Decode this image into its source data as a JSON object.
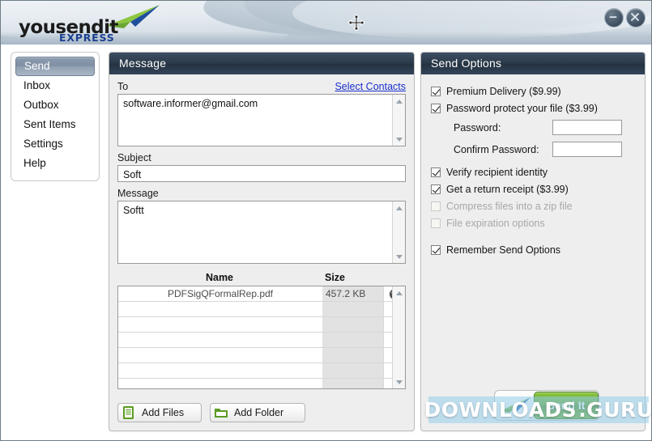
{
  "window": {
    "logo_word": "yousendit",
    "logo_sub": "EXPRESS",
    "minimize_label": "–",
    "close_label": "×",
    "cursor": "move-cursor"
  },
  "sidebar": {
    "items": [
      {
        "label": "Send",
        "selected": true
      },
      {
        "label": "Inbox",
        "selected": false
      },
      {
        "label": "Outbox",
        "selected": false
      },
      {
        "label": "Sent Items",
        "selected": false
      },
      {
        "label": "Settings",
        "selected": false
      },
      {
        "label": "Help",
        "selected": false
      }
    ]
  },
  "message_panel": {
    "title": "Message",
    "to_label": "To",
    "select_contacts_label": "Select Contacts",
    "to_value": "software.informer@gmail.com",
    "subject_label": "Subject",
    "subject_value": "Soft",
    "message_label": "Message",
    "message_value": "Softt",
    "table": {
      "columns": [
        "Name",
        "Size"
      ],
      "rows": [
        {
          "name": "PDFSigQFormalRep.pdf",
          "size": "457.2 KB"
        },
        {
          "name": "",
          "size": ""
        },
        {
          "name": "",
          "size": ""
        },
        {
          "name": "",
          "size": ""
        },
        {
          "name": "",
          "size": ""
        },
        {
          "name": "",
          "size": ""
        },
        {
          "name": "",
          "size": ""
        }
      ]
    },
    "add_files_label": "Add Files",
    "add_folder_label": "Add Folder"
  },
  "send_options": {
    "title": "Send Options",
    "options": [
      {
        "label": "Premium Delivery ($9.99)",
        "checked": true,
        "disabled": false
      },
      {
        "label": "Password protect your file ($3.99)",
        "checked": true,
        "disabled": false
      },
      {
        "label": "Verify recipient identity",
        "checked": true,
        "disabled": false
      },
      {
        "label": "Get a return receipt ($3.99)",
        "checked": true,
        "disabled": false
      },
      {
        "label": "Compress files into a zip file",
        "checked": false,
        "disabled": true
      },
      {
        "label": "File expiration options",
        "checked": false,
        "disabled": true
      },
      {
        "label": "Remember Send Options",
        "checked": true,
        "disabled": false
      }
    ],
    "password_label": "Password:",
    "password_value": "",
    "confirm_password_label": "Confirm Password:",
    "confirm_password_value": "",
    "send_button_label": "Send It"
  },
  "watermark": {
    "text_left": "DOWNLOADS",
    "text_right": ".GURU"
  },
  "colors": {
    "panel_header": "#2c3a4a",
    "accent_green": "#5e9e28",
    "link_blue": "#1a2fd0",
    "logo_blue": "#1b3f8f",
    "watermark_band": "#96cdeb"
  }
}
